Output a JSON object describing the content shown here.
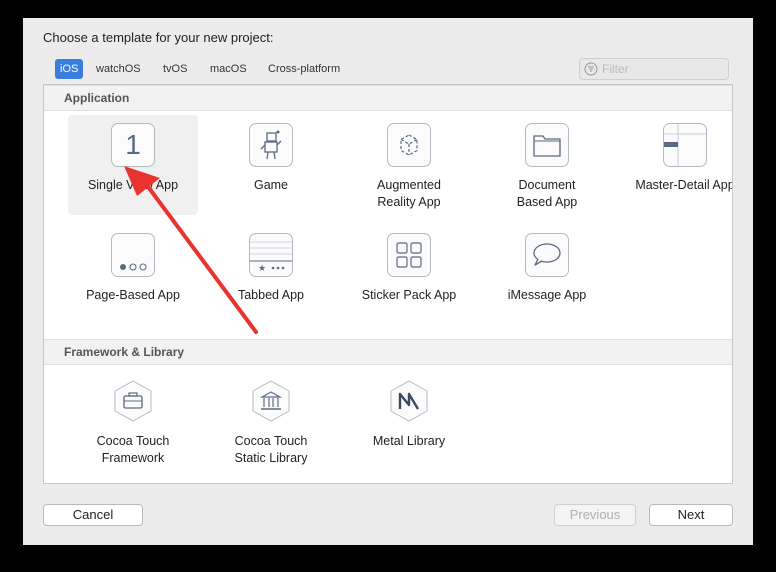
{
  "dialog": {
    "prompt": "Choose a template for your new project:"
  },
  "platforms": [
    "iOS",
    "watchOS",
    "tvOS",
    "macOS",
    "Cross-platform"
  ],
  "selected_platform": "iOS",
  "filter": {
    "placeholder": "Filter"
  },
  "sections": [
    {
      "title": "Application",
      "templates": [
        {
          "label": "Single View App",
          "icon": "single-view-icon",
          "selected": true
        },
        {
          "label": "Game",
          "icon": "game-icon"
        },
        {
          "label": "Augmented\nReality App",
          "icon": "ar-icon"
        },
        {
          "label": "Document\nBased App",
          "icon": "document-icon"
        },
        {
          "label": "Master-Detail App",
          "icon": "master-detail-icon"
        },
        {
          "label": "Page-Based App",
          "icon": "page-based-icon"
        },
        {
          "label": "Tabbed App",
          "icon": "tabbed-icon"
        },
        {
          "label": "Sticker Pack App",
          "icon": "sticker-pack-icon"
        },
        {
          "label": "iMessage App",
          "icon": "imessage-icon"
        }
      ]
    },
    {
      "title": "Framework & Library",
      "templates": [
        {
          "label": "Cocoa Touch\nFramework",
          "icon": "framework-icon"
        },
        {
          "label": "Cocoa Touch\nStatic Library",
          "icon": "static-library-icon"
        },
        {
          "label": "Metal Library",
          "icon": "metal-library-icon"
        }
      ]
    }
  ],
  "buttons": {
    "cancel": "Cancel",
    "previous": "Previous",
    "next": "Next"
  },
  "colors": {
    "accent": "#3b7ddd",
    "annotation_arrow": "#e8332f"
  }
}
